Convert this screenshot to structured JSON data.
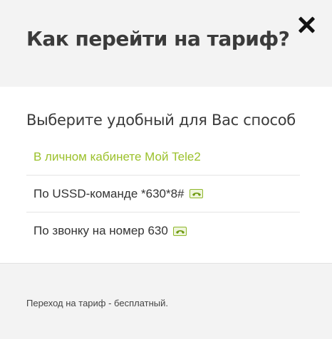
{
  "modal": {
    "title": "Как перейти на тариф?",
    "close_icon": "close-icon"
  },
  "body": {
    "subtitle": "Выберите удобный для Вас способ",
    "options": [
      {
        "label": "В личном кабинете Мой Tele2",
        "icon": null
      },
      {
        "label": "По USSD-команде *630*8#",
        "icon": "phone-icon"
      },
      {
        "label": "По звонку на номер 630",
        "icon": "phone-icon"
      }
    ]
  },
  "footer": {
    "note": "Переход на тариф - бесплатный."
  },
  "colors": {
    "accent": "#9bc12b",
    "header_bg": "#f3f3f3",
    "body_bg": "#ffffff",
    "text": "#333333"
  }
}
